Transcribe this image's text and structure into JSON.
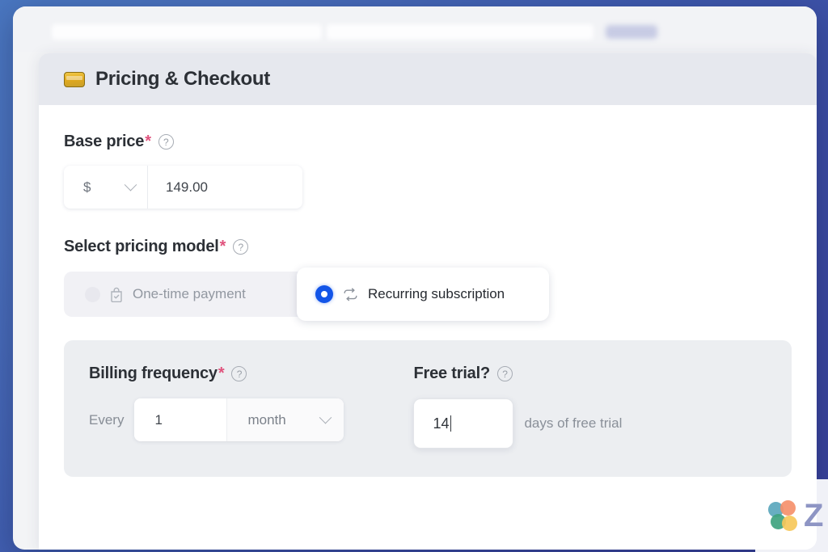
{
  "theme": {
    "background_gradient_from": "#4a77c0",
    "background_gradient_to": "#38409a",
    "accent_blue": "#1355e8",
    "required_star_color": "#e0537d",
    "panel_header_bg": "#e6e8ee",
    "billing_panel_bg": "#eceef1"
  },
  "panel": {
    "icon": "credit-card-icon",
    "title": "Pricing & Checkout"
  },
  "base_price": {
    "label": "Base price",
    "required_marker": "*",
    "help": "?",
    "currency": {
      "value": "$",
      "chevron": "chevron-down-icon"
    },
    "amount": "149.00"
  },
  "pricing_model": {
    "label": "Select pricing model",
    "required_marker": "*",
    "help": "?",
    "options": [
      {
        "id": "one-time",
        "label": "One-time payment",
        "icon": "shopping-bag-check-icon",
        "selected": false
      },
      {
        "id": "recurring",
        "label": "Recurring subscription",
        "icon": "repeat-arrows-icon",
        "selected": true
      }
    ]
  },
  "billing": {
    "frequency": {
      "label": "Billing frequency",
      "required_marker": "*",
      "help": "?",
      "every_label": "Every",
      "count": "1",
      "unit": "month",
      "chevron": "chevron-down-icon"
    },
    "free_trial": {
      "label": "Free trial?",
      "help": "?",
      "days": "14",
      "suffix": "days of free trial"
    }
  },
  "watermark": {
    "logo": "butterfly-logo",
    "letter": "Z"
  }
}
